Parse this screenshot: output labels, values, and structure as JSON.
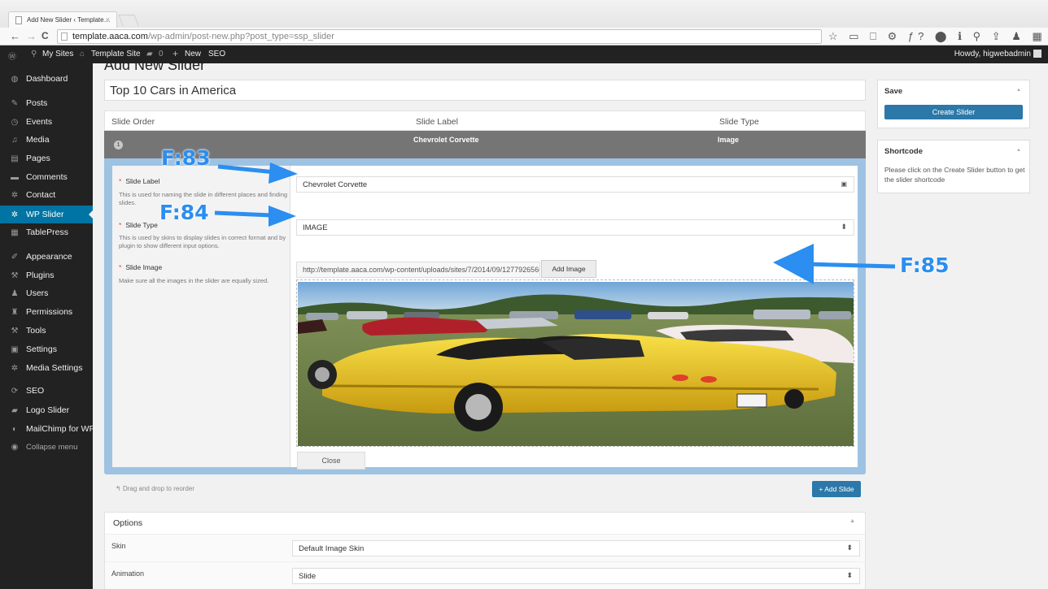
{
  "browser": {
    "tab_title": "Add New Slider ‹ Template…",
    "tab_close": "×",
    "url_host": "template.aaca.com",
    "url_path": "/wp-admin/post-new.php?post_type=ssp_slider",
    "back": "←",
    "forward": "→",
    "reload": "C",
    "extensions": "☆ ▭ ⎕ ⚙ ƒ? ⬤ ℹ ⚲ ⇪ ♟ ▦ ≡"
  },
  "adminbar": {
    "wp_logo": "Ⓦ",
    "my_sites": "My Sites",
    "site_name": "Template Site",
    "comments_count": "0",
    "new_label": "New",
    "seo_label": "SEO",
    "howdy": "Howdy, higwebadmin"
  },
  "sidebar": {
    "items": [
      {
        "icon": "◍",
        "label": "Dashboard"
      },
      {
        "icon": "✎",
        "label": "Posts"
      },
      {
        "icon": "◷",
        "label": "Events"
      },
      {
        "icon": "♫",
        "label": "Media"
      },
      {
        "icon": "▤",
        "label": "Pages"
      },
      {
        "icon": "▬",
        "label": "Comments"
      },
      {
        "icon": "✲",
        "label": "Contact"
      },
      {
        "icon": "✲",
        "label": "WP Slider"
      },
      {
        "icon": "▦",
        "label": "TablePress"
      },
      {
        "icon": "✐",
        "label": "Appearance"
      },
      {
        "icon": "⚒",
        "label": "Plugins"
      },
      {
        "icon": "♟",
        "label": "Users"
      },
      {
        "icon": "♜",
        "label": "Permissions"
      },
      {
        "icon": "⚒",
        "label": "Tools"
      },
      {
        "icon": "▣",
        "label": "Settings"
      },
      {
        "icon": "✲",
        "label": "Media Settings"
      },
      {
        "icon": "⟳",
        "label": "SEO"
      },
      {
        "icon": "▰",
        "label": "Logo Slider"
      },
      {
        "icon": "◐",
        "label": "MailChimp for WP"
      },
      {
        "icon": "◉",
        "label": "Collapse menu"
      }
    ]
  },
  "page": {
    "title": "Add New Slider",
    "slider_title": "Top 10 Cars in America"
  },
  "slides_table": {
    "headers": [
      "Slide Order",
      "Slide Label",
      "Slide Type"
    ],
    "row": {
      "order": "1",
      "label": "Chevrolet Corvette",
      "type": "Image"
    }
  },
  "slide_editor": {
    "label_field": {
      "label": "Slide Label",
      "desc": "This is used for naming the slide in different places and finding slides.",
      "value": "Chevrolet Corvette"
    },
    "type_field": {
      "label": "Slide Type",
      "desc": "This is used by skins to display slides in correct format and by plugin to show different input options.",
      "value": "IMAGE"
    },
    "image_field": {
      "label": "Slide Image",
      "desc": "Make sure all the images in the slider are equally sized.",
      "value": "http://template.aaca.com/wp-content/uploads/sites/7/2014/09/1277926566_top-10-american-cars-of-all-time_1.jpg",
      "add_button": "Add Image"
    },
    "close_button": "Close",
    "required_mark": "*"
  },
  "drag_hint": "Drag and drop to reorder",
  "add_slide_button": "+ Add Slide",
  "options": {
    "title": "Options",
    "rows": [
      {
        "label": "Skin",
        "value": "Default Image Skin"
      },
      {
        "label": "Animation",
        "value": "Slide"
      }
    ]
  },
  "save_box": {
    "title": "Save",
    "button": "Create Slider"
  },
  "shortcode_box": {
    "title": "Shortcode",
    "text": "Please click on the Create Slider button to get the slider shortcode"
  },
  "annotations": {
    "f83": "F:83",
    "f84": "F:84",
    "f85": "F:85"
  },
  "colors": {
    "annotation_blue": "#2b8ef0",
    "active_menu": "#0074a2",
    "primary_button": "#2b78a9",
    "editor_border": "#9ec2e2"
  }
}
